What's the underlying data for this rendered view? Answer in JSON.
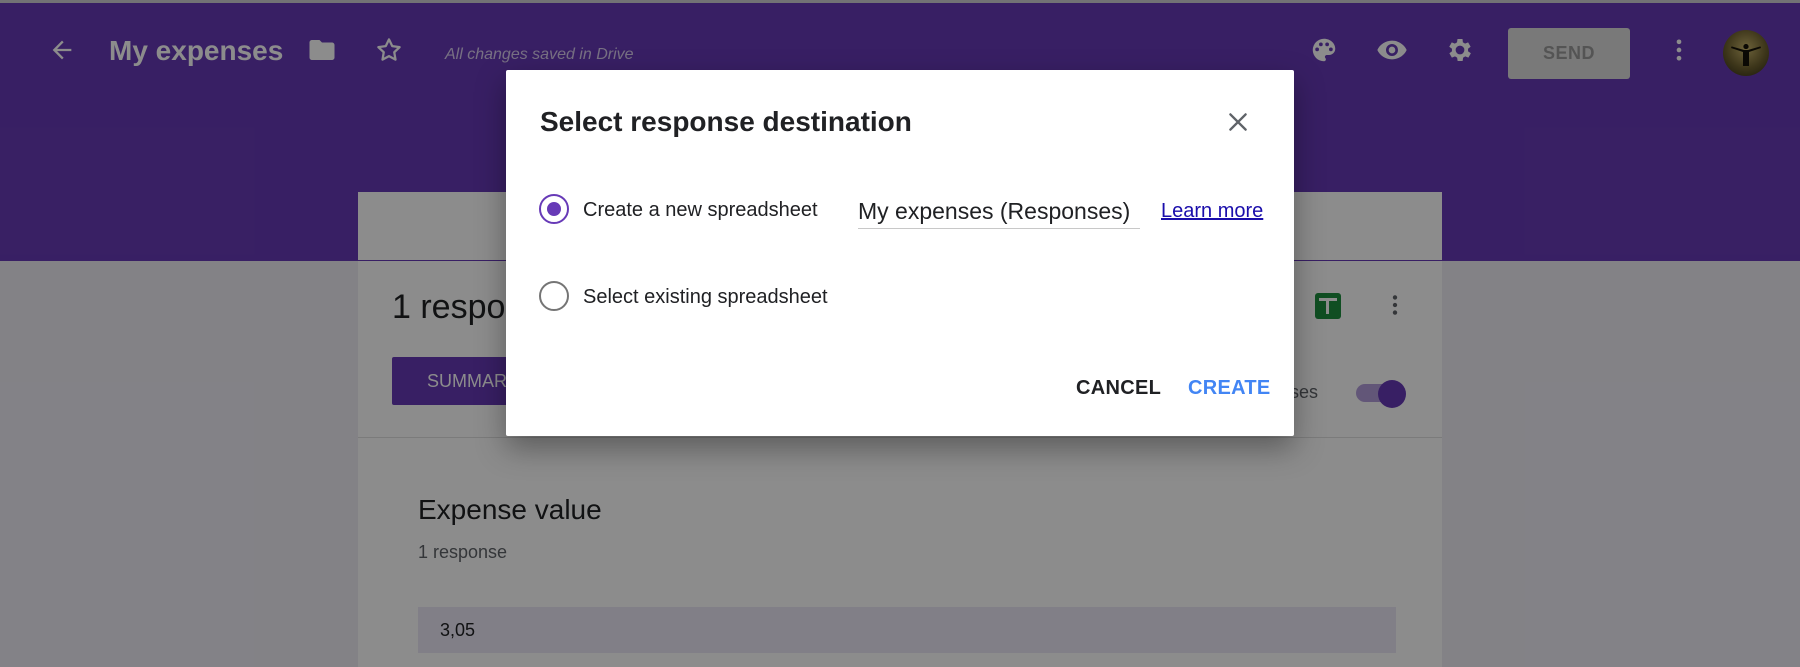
{
  "header": {
    "title": "My expenses",
    "saved_status": "All changes saved in Drive",
    "send_label": "SEND",
    "icons": [
      "back-arrow-icon",
      "folder-icon",
      "star-icon",
      "palette-icon",
      "eye-icon",
      "gear-icon",
      "more-vert-icon"
    ]
  },
  "responses": {
    "title": "1 respo",
    "tab_summary": "SUMMAR",
    "accepting_label": "nses",
    "accepting_on": true
  },
  "question": {
    "title": "Expense value",
    "count": "1 response",
    "answer": "3,05"
  },
  "dialog": {
    "title": "Select response destination",
    "option_new_label": "Create a new spreadsheet",
    "option_new_selected": true,
    "new_sheet_name": "My expenses (Responses)",
    "learn_more": "Learn more",
    "option_existing_label": "Select existing spreadsheet",
    "option_existing_selected": false,
    "cancel_label": "CANCEL",
    "create_label": "CREATE"
  },
  "colors": {
    "brand": "#673ab7",
    "link": "#1a0dab",
    "accent_button": "#4285f4",
    "sheets": "#1e8e3e"
  }
}
